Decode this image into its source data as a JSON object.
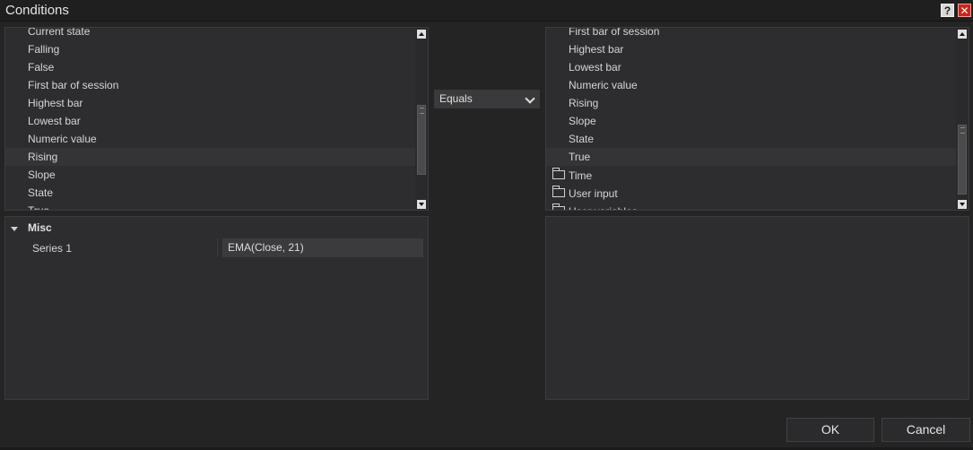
{
  "window": {
    "title": "Conditions",
    "help_label": "?",
    "close_label": "✕"
  },
  "left_list": {
    "items": [
      {
        "label": "Current state"
      },
      {
        "label": "Falling"
      },
      {
        "label": "False"
      },
      {
        "label": "First bar of session"
      },
      {
        "label": "Highest bar"
      },
      {
        "label": "Lowest bar"
      },
      {
        "label": "Numeric value"
      },
      {
        "label": "Rising",
        "selected": true
      },
      {
        "label": "Slope"
      },
      {
        "label": "State"
      },
      {
        "label": "True"
      }
    ]
  },
  "operator": {
    "selected": "Equals"
  },
  "right_list": {
    "items": [
      {
        "label": "First bar of session"
      },
      {
        "label": "Highest bar"
      },
      {
        "label": "Lowest bar"
      },
      {
        "label": "Numeric value"
      },
      {
        "label": "Rising"
      },
      {
        "label": "Slope"
      },
      {
        "label": "State"
      },
      {
        "label": "True",
        "selected": true
      },
      {
        "label": "Time",
        "folder": true
      },
      {
        "label": "User input",
        "folder": true
      },
      {
        "label": "User variables",
        "folder": true
      }
    ]
  },
  "properties": {
    "category": "Misc",
    "rows": [
      {
        "label": "Series 1",
        "value": "EMA(Close, 21)"
      }
    ]
  },
  "buttons": {
    "ok_label": "OK",
    "cancel_label": "Cancel"
  }
}
